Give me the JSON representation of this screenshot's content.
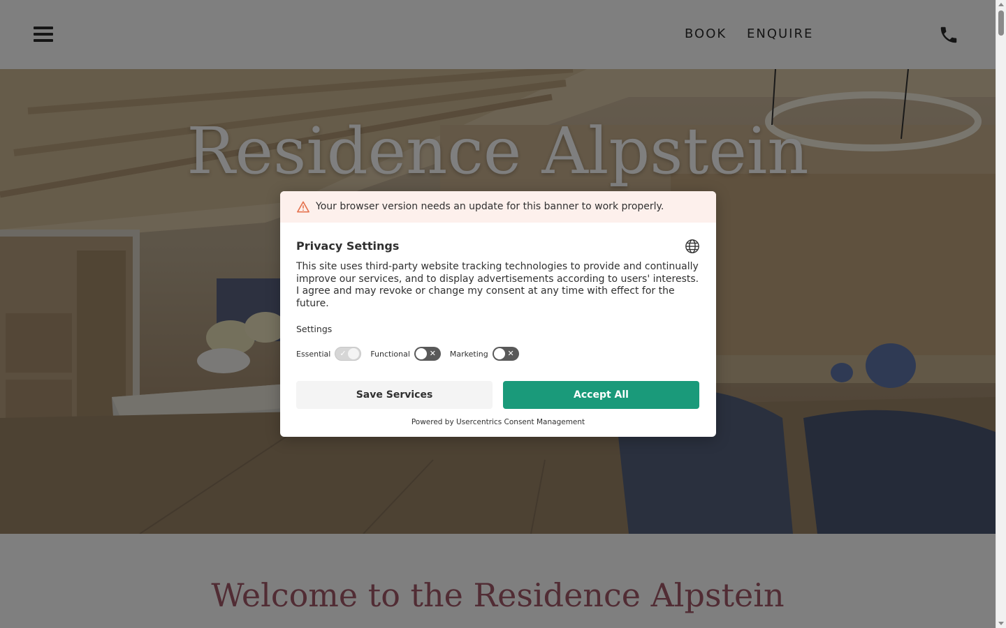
{
  "header": {
    "nav_book": "BOOK",
    "nav_enquire": "ENQUIRE",
    "menu_icon": "hamburger-menu-icon",
    "phone_icon": "phone-icon"
  },
  "hero": {
    "title": "Residence Alpstein"
  },
  "welcome": {
    "heading": "Welcome to the Residence Alpstein"
  },
  "consent": {
    "warning": "Your browser version needs an update for this banner to work properly.",
    "title": "Privacy Settings",
    "description": "This site uses third-party website tracking technologies to provide and continually improve our services, and to display advertisements according to users' interests. I agree and may revoke or change my consent at any time with effect for the future.",
    "settings_label": "Settings",
    "toggles": [
      {
        "label": "Essential",
        "state": "on-disabled"
      },
      {
        "label": "Functional",
        "state": "off"
      },
      {
        "label": "Marketing",
        "state": "off"
      }
    ],
    "save_button": "Save Services",
    "accept_button": "Accept All",
    "powered_by": "Powered by Usercentrics Consent Management"
  },
  "colors": {
    "accept_green": "#1a9a7a",
    "welcome_rose": "#a25868",
    "warning_bg": "#fdf0ec",
    "warning_icon": "#e5734f"
  }
}
